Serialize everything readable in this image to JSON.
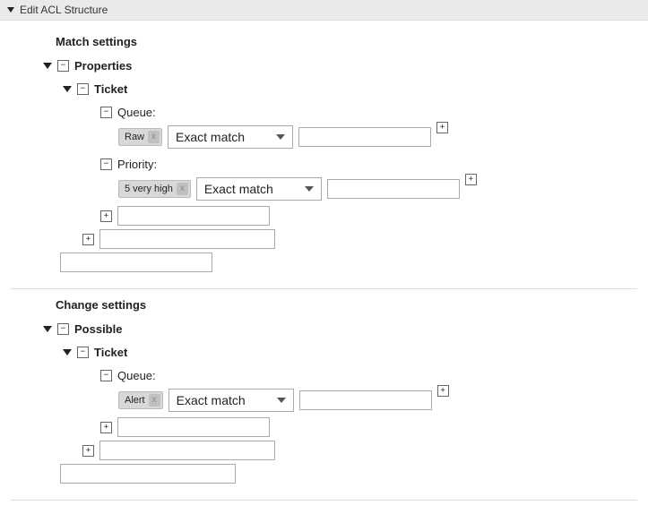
{
  "panel": {
    "title": "Edit ACL Structure"
  },
  "match": {
    "title": "Match settings",
    "properties": {
      "label": "Properties",
      "ticket": {
        "label": "Ticket",
        "fields": {
          "queue": {
            "label": "Queue:",
            "tag": "Raw",
            "match_mode": "Exact match",
            "value": ""
          },
          "priority": {
            "label": "Priority:",
            "tag": "5 very high",
            "match_mode": "Exact match",
            "value": ""
          }
        }
      }
    }
  },
  "change": {
    "title": "Change settings",
    "possible": {
      "label": "Possible",
      "ticket": {
        "label": "Ticket",
        "fields": {
          "queue": {
            "label": "Queue:",
            "tag": "Alert",
            "match_mode": "Exact match",
            "value": ""
          }
        }
      }
    }
  },
  "icons": {
    "plus": "+",
    "minus": "−",
    "power": "⏻"
  }
}
